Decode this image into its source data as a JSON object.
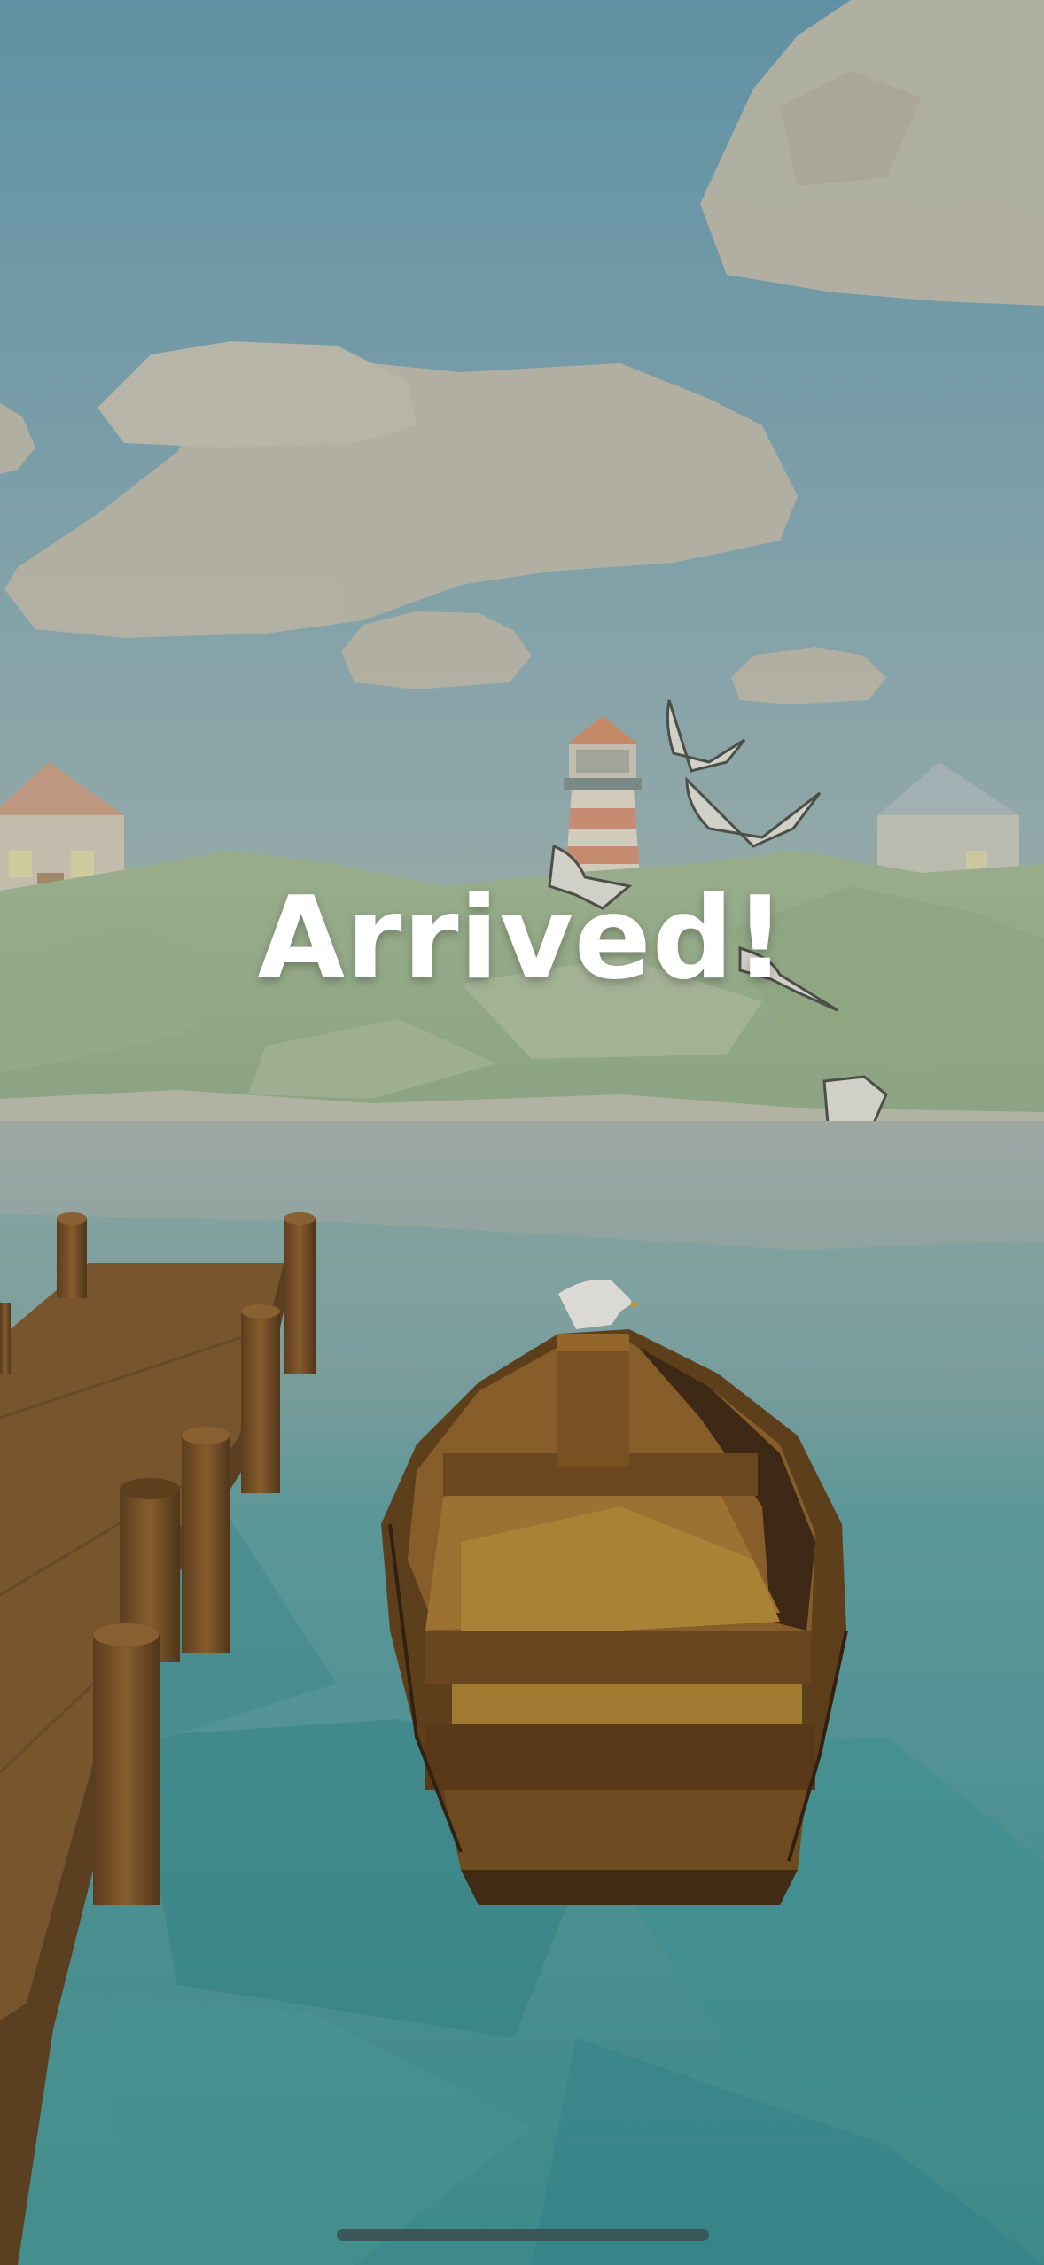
{
  "overlay": {
    "title": "Arrived!"
  },
  "scene": {
    "objects": [
      "sky",
      "clouds",
      "hills",
      "lighthouse",
      "houses",
      "seagulls",
      "sea",
      "dock",
      "rowboat"
    ],
    "colors": {
      "sky": "#6f9ab0",
      "cloud": "#bcb6a6",
      "hill": "#8ba47e",
      "sea": "#3f8c8f",
      "wood": "#7a5226",
      "text": "#ffffff"
    }
  }
}
